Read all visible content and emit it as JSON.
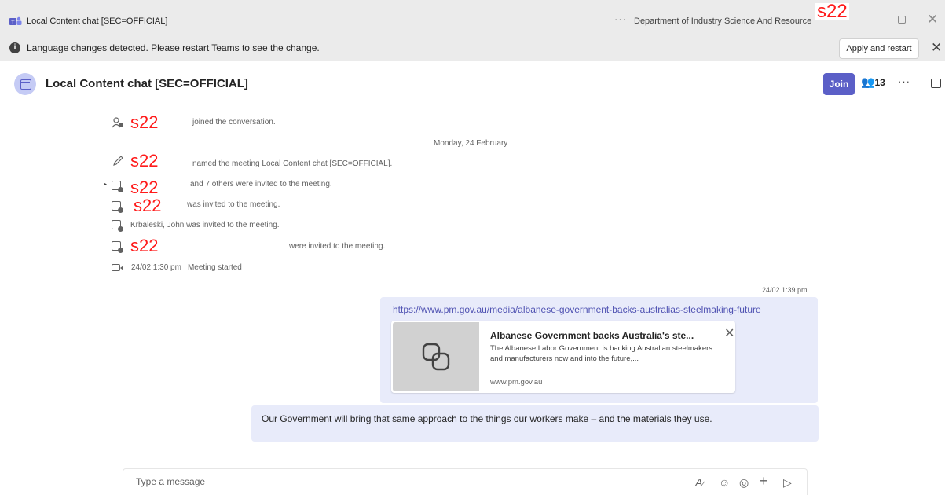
{
  "window": {
    "title": "Local Content chat [SEC=OFFICIAL]",
    "org": "Department of Industry Science And Resource",
    "redaction": "s22"
  },
  "notification": {
    "message": "Language changes detected. Please restart Teams to see the change.",
    "apply_label": "Apply and restart"
  },
  "chat": {
    "name": "Local Content chat [SEC=OFFICIAL]",
    "join_label": "Join",
    "participants": "13"
  },
  "events": {
    "redaction": "s22",
    "joined": "joined the conversation.",
    "date_divider": "Monday, 24 February",
    "renamed": "named the meeting Local Content chat [SEC=OFFICIAL].",
    "invited_others": "and 7 others were invited to the meeting.",
    "invited_one": "was invited to the meeting.",
    "invited_named": "Krbaleski, John was invited to the meeting.",
    "invited_plural": "were invited to the meeting.",
    "meeting_time": "24/02 1:30 pm",
    "meeting_started": "Meeting started"
  },
  "messages": {
    "timestamp": "24/02 1:39 pm",
    "link": "https://www.pm.gov.au/media/albanese-government-backs-australias-steelmaking-future",
    "card_title": "Albanese Government backs Australia's ste...",
    "card_desc": "The Albanese Labor Government is backing Australian steelmakers and manufacturers now and into the future,...",
    "card_domain": "www.pm.gov.au",
    "text": "Our Government will bring that same approach to the things our workers make – and the materials they use."
  },
  "compose": {
    "placeholder": "Type a message"
  }
}
